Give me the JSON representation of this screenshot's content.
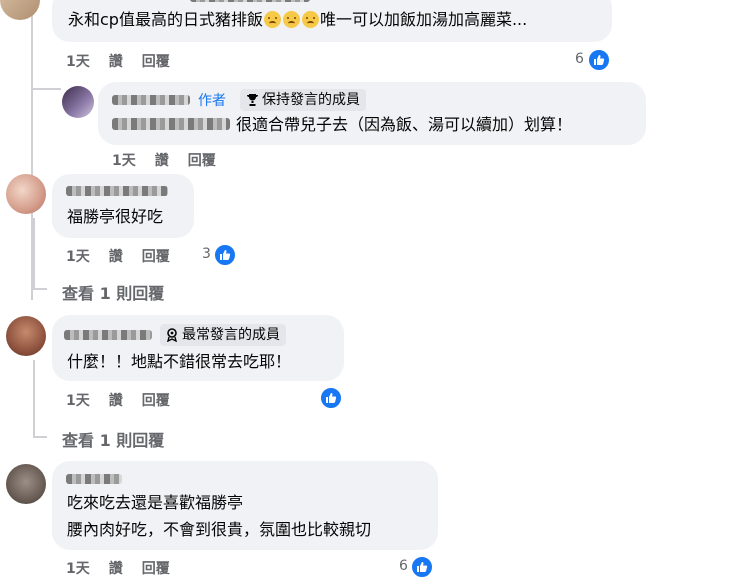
{
  "comments": [
    {
      "text": "永和cp值最高的日式豬排飯",
      "text_after_emoji": "唯一可以加飯加湯加高麗菜...",
      "time": "1天",
      "like": "讚",
      "reply": "回覆",
      "reactions": "6"
    },
    {
      "author_tag": "作者",
      "badge": "保持發言的成員",
      "text": "很適合帶兒子去（因為飯、湯可以續加）划算！",
      "time": "1天",
      "like": "讚",
      "reply": "回覆"
    },
    {
      "text": "福勝亭很好吃",
      "time": "1天",
      "like": "讚",
      "reply": "回覆",
      "reactions": "3",
      "view_replies": "查看 1 則回覆"
    },
    {
      "badge": "最常發言的成員",
      "text": "什麼！！地點不錯很常去吃耶！",
      "time": "1天",
      "like": "讚",
      "reply": "回覆",
      "view_replies": "查看 1 則回覆"
    },
    {
      "text_line1": "吃來吃去還是喜歡福勝亭",
      "text_line2": "腰內肉好吃，不會到很貴，氛圍也比較親切",
      "time": "1天",
      "like": "讚",
      "reply": "回覆",
      "reactions": "6"
    }
  ],
  "colors": {
    "bubble": "#f0f2f5",
    "like_blue": "#1877f2",
    "meta_gray": "#65676b",
    "badge_bg": "#e4e6eb"
  },
  "icons": [
    "like-icon",
    "trophy-icon",
    "member-badge-icon"
  ]
}
